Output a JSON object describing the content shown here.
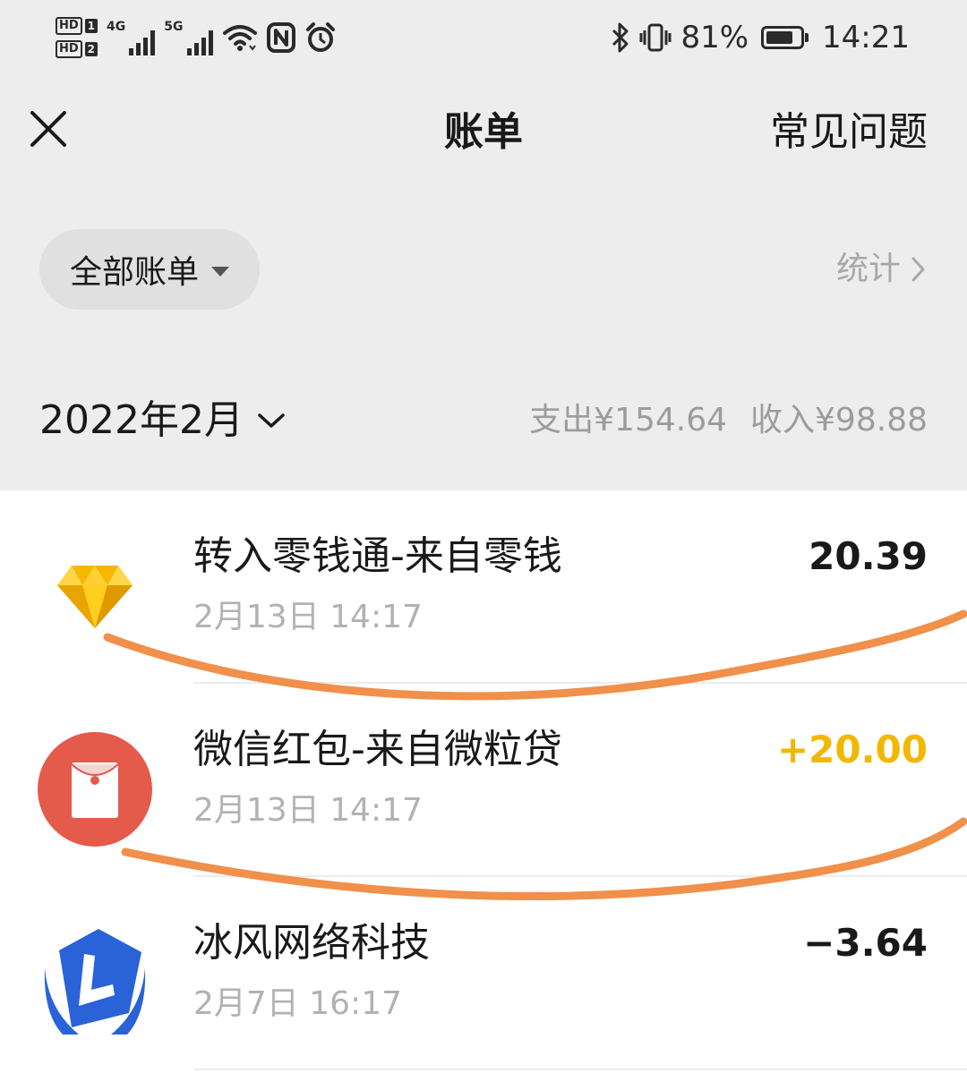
{
  "status_bar": {
    "sim1": "HD",
    "sim1_num": "1",
    "sim2": "HD",
    "sim2_num": "2",
    "net1": "4G",
    "net2": "5G",
    "battery_percent": "81%",
    "battery_level": 0.81,
    "time": "14:21",
    "icons": [
      "signal-icon",
      "wifi-icon",
      "nfc-icon",
      "alarm-icon",
      "bluetooth-icon",
      "vibrate-icon",
      "battery-icon"
    ]
  },
  "navbar": {
    "title": "账单",
    "faq_label": "常见问题",
    "close_icon": "close-icon"
  },
  "filter": {
    "label": "全部账单",
    "stats_label": "统计"
  },
  "month": {
    "label": "2022年2月",
    "expense": "支出¥154.64",
    "income": "收入¥98.88"
  },
  "colors": {
    "income_amount": "#f2b800",
    "red_packet": "#e45a4b",
    "diamond": "#f5b800",
    "brand_blue": "#2a62d8",
    "annotation_stroke": "#f0904a"
  },
  "transactions": [
    {
      "title": "转入零钱通-来自零钱",
      "time": "2月13日 14:17",
      "amount": "20.39",
      "icon": "diamond-icon"
    },
    {
      "title": "微信红包-来自微粒贷",
      "time": "2月13日 14:17",
      "amount": "+20.00",
      "icon": "red-packet-icon"
    },
    {
      "title": "冰风网络科技",
      "time": "2月7日 16:17",
      "amount": "−3.64",
      "icon": "merchant-logo-icon"
    }
  ]
}
